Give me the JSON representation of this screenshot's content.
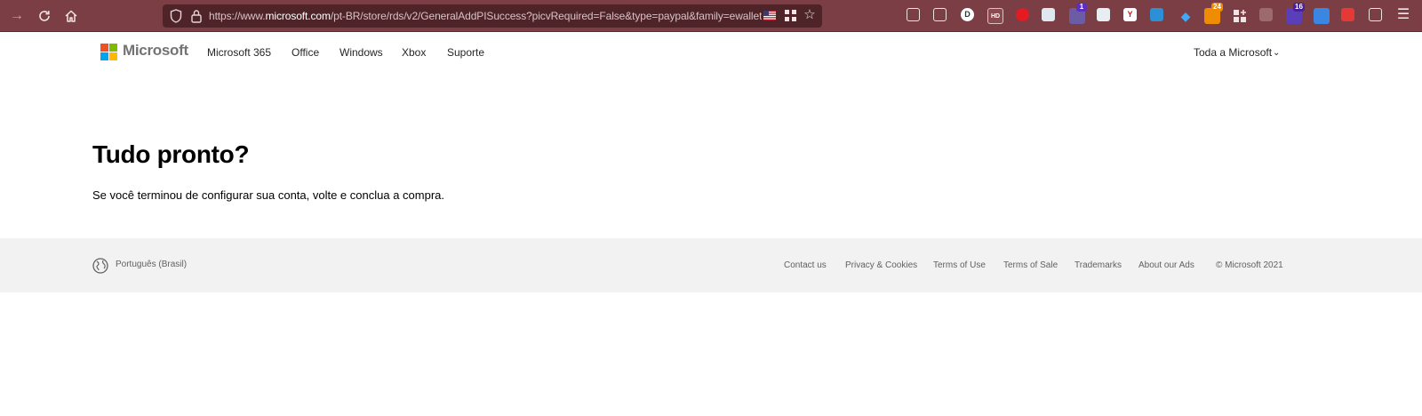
{
  "browser": {
    "url_prefix": "https://www.",
    "url_domain": "microsoft.com",
    "url_path": "/pt-BR/store/rds/v2/GeneralAddPISuccess?picvRequired=False&type=paypal&family=ewallet",
    "extension_badges": {
      "ext_3": "1",
      "ext_12": "24",
      "ext_14": "16"
    },
    "icons": [
      "forward-icon",
      "reload-icon",
      "home-icon",
      "shield-icon",
      "lock-icon",
      "flag-icon",
      "grid-icon",
      "bookmark-star-icon",
      "menu-icon"
    ]
  },
  "header": {
    "brand": "Microsoft",
    "nav": [
      "Microsoft 365",
      "Office",
      "Windows",
      "Xbox",
      "Suporte"
    ],
    "all_microsoft": "Toda a Microsoft",
    "logo_colors": [
      "#f25022",
      "#7fba00",
      "#00a4ef",
      "#ffb900"
    ]
  },
  "main": {
    "title": "Tudo pronto?",
    "message": "Se você terminou de configurar sua conta, volte e conclua a compra."
  },
  "footer": {
    "language": "Português (Brasil)",
    "links": [
      "Contact us",
      "Privacy & Cookies",
      "Terms of Use",
      "Terms of Sale",
      "Trademarks",
      "About our Ads"
    ],
    "copyright": "© Microsoft 2021"
  },
  "colors": {
    "toolbar_bg": "#7a3e44",
    "urlbar_bg": "#4f2429",
    "footer_bg": "#f2f2f2"
  }
}
